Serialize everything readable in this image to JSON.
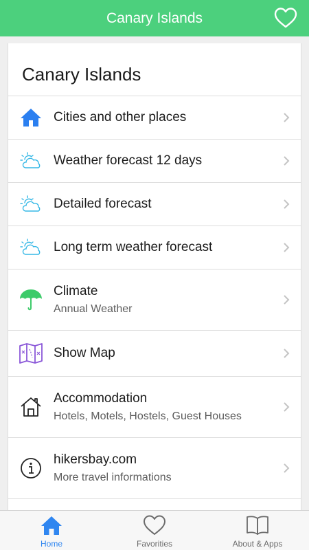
{
  "header": {
    "title": "Canary Islands"
  },
  "card": {
    "title": "Canary Islands",
    "items": [
      {
        "title": "Cities and other places",
        "subtitle": "",
        "icon": "home-icon"
      },
      {
        "title": "Weather forecast 12 days",
        "subtitle": "",
        "icon": "sun-cloud-icon"
      },
      {
        "title": "Detailed forecast",
        "subtitle": "",
        "icon": "sun-cloud-icon"
      },
      {
        "title": "Long term weather forecast",
        "subtitle": "",
        "icon": "sun-cloud-icon"
      },
      {
        "title": "Climate",
        "subtitle": "Annual Weather",
        "icon": "umbrella-icon"
      },
      {
        "title": "Show Map",
        "subtitle": "",
        "icon": "map-icon"
      },
      {
        "title": "Accommodation",
        "subtitle": "Hotels, Motels, Hostels, Guest Houses",
        "icon": "house-outline-icon"
      },
      {
        "title": "hikersbay.com",
        "subtitle": "More travel informations",
        "icon": "info-icon"
      }
    ]
  },
  "tabs": [
    {
      "label": "Home",
      "icon": "home-icon",
      "active": true
    },
    {
      "label": "Favorities",
      "icon": "heart-icon",
      "active": false
    },
    {
      "label": "About & Apps",
      "icon": "book-icon",
      "active": false
    }
  ],
  "colors": {
    "accent_green": "#4cd07d",
    "tab_active_blue": "#2f86f0",
    "home_blue": "#2b7ff0",
    "weather_cyan": "#36b8e6",
    "umbrella_green": "#3dcb6a",
    "map_purple": "#8a57d8"
  }
}
